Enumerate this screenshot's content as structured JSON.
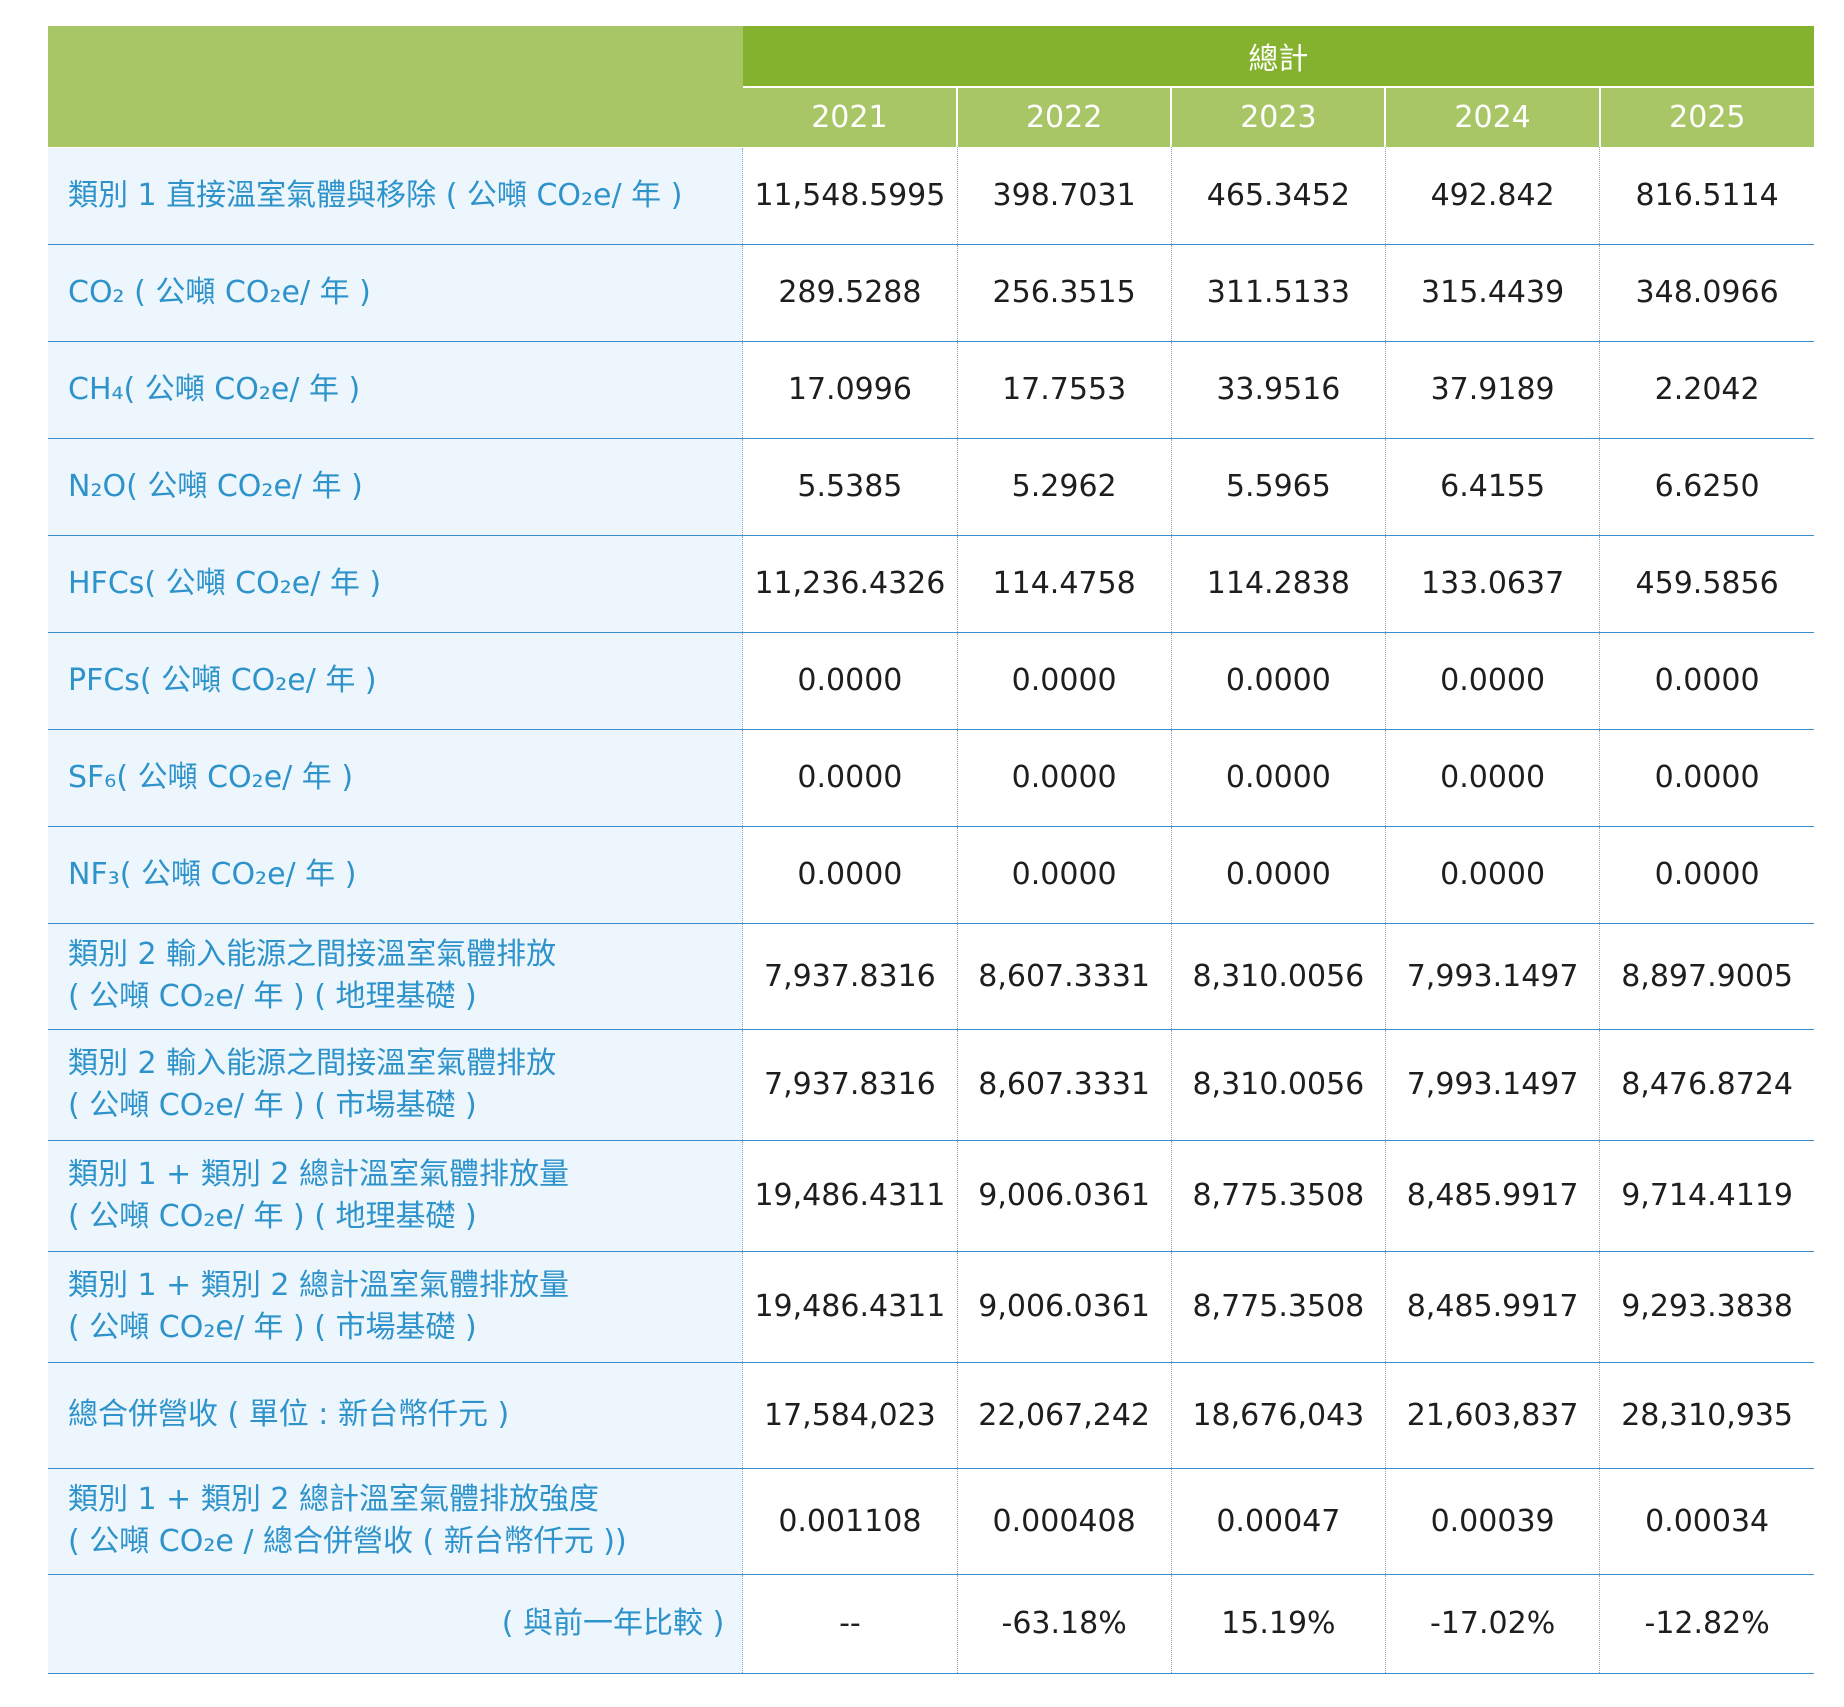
{
  "header": {
    "total_label": "總計",
    "years": [
      "2021",
      "2022",
      "2023",
      "2024",
      "2025"
    ]
  },
  "rows": [
    {
      "label": "類別 1 直接溫室氣體與移除 ( 公噸 CO₂e/ 年 )",
      "values": [
        "11,548.5995",
        "398.7031",
        "465.3452",
        "492.842",
        "816.5114"
      ]
    },
    {
      "label": "CO₂ ( 公噸 CO₂e/ 年 )",
      "values": [
        "289.5288",
        "256.3515",
        "311.5133",
        "315.4439",
        "348.0966"
      ]
    },
    {
      "label": "CH₄( 公噸 CO₂e/ 年 )",
      "values": [
        "17.0996",
        "17.7553",
        "33.9516",
        "37.9189",
        "2.2042"
      ]
    },
    {
      "label": "N₂O( 公噸 CO₂e/ 年 )",
      "values": [
        "5.5385",
        "5.2962",
        "5.5965",
        "6.4155",
        "6.6250"
      ]
    },
    {
      "label": "HFCs( 公噸 CO₂e/ 年 )",
      "values": [
        "11,236.4326",
        "114.4758",
        "114.2838",
        "133.0637",
        "459.5856"
      ]
    },
    {
      "label": "PFCs( 公噸 CO₂e/ 年 )",
      "values": [
        "0.0000",
        "0.0000",
        "0.0000",
        "0.0000",
        "0.0000"
      ]
    },
    {
      "label": "SF₆( 公噸 CO₂e/ 年 )",
      "values": [
        "0.0000",
        "0.0000",
        "0.0000",
        "0.0000",
        "0.0000"
      ]
    },
    {
      "label": "NF₃( 公噸 CO₂e/ 年 )",
      "values": [
        "0.0000",
        "0.0000",
        "0.0000",
        "0.0000",
        "0.0000"
      ]
    },
    {
      "label_line1": "類別 2 輸入能源之間接溫室氣體排放",
      "label_line2": "( 公噸 CO₂e/ 年 ) ( 地理基礎 )",
      "values": [
        "7,937.8316",
        "8,607.3331",
        "8,310.0056",
        "7,993.1497",
        "8,897.9005"
      ]
    },
    {
      "label_line1": "類別 2 輸入能源之間接溫室氣體排放",
      "label_line2": "( 公噸 CO₂e/ 年 ) ( 市場基礎 )",
      "values": [
        "7,937.8316",
        "8,607.3331",
        "8,310.0056",
        "7,993.1497",
        "8,476.8724"
      ]
    },
    {
      "label_line1": "類別 1 + 類別 2 總計溫室氣體排放量",
      "label_line2": "( 公噸 CO₂e/ 年 ) ( 地理基礎 )",
      "values": [
        "19,486.4311",
        "9,006.0361",
        "8,775.3508",
        "8,485.9917",
        "9,714.4119"
      ]
    },
    {
      "label_line1": "類別 1 + 類別 2 總計溫室氣體排放量",
      "label_line2": "( 公噸 CO₂e/ 年 ) ( 市場基礎 )",
      "values": [
        "19,486.4311",
        "9,006.0361",
        "8,775.3508",
        "8,485.9917",
        "9,293.3838"
      ]
    },
    {
      "label": "總合併營收 ( 單位 : 新台幣仟元 )",
      "values": [
        "17,584,023",
        "22,067,242",
        "18,676,043",
        "21,603,837",
        "28,310,935"
      ]
    },
    {
      "label_line1": "類別 1 + 類別 2 總計溫室氣體排放強度",
      "label_line2": "( 公噸 CO₂e / 總合併營收 ( 新台幣仟元 ))",
      "values": [
        "0.001108",
        "0.000408",
        "0.00047",
        "0.00039",
        "0.00034"
      ]
    },
    {
      "label": "( 與前一年比較 )",
      "values": [
        "--",
        "-63.18%",
        "15.19%",
        "-17.02%",
        "-12.82%"
      ]
    }
  ]
}
